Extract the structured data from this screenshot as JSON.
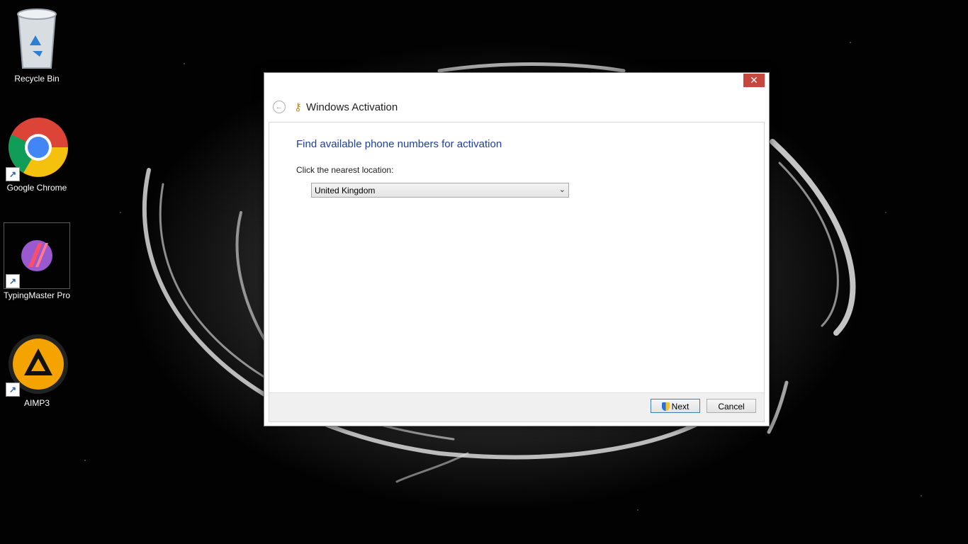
{
  "desktop": {
    "icons": [
      {
        "label": "Recycle Bin"
      },
      {
        "label": "Google Chrome"
      },
      {
        "label": "TypingMaster Pro"
      },
      {
        "label": "AIMP3"
      }
    ]
  },
  "dialog": {
    "title": "Windows Activation",
    "heading": "Find available phone numbers for activation",
    "prompt": "Click the nearest location:",
    "location_select": {
      "selected": "United Kingdom"
    },
    "buttons": {
      "next": "Next",
      "cancel": "Cancel"
    },
    "close_glyph": "✕"
  },
  "colors": {
    "heading": "#1e3f9a",
    "close_button": "#c7473f"
  }
}
